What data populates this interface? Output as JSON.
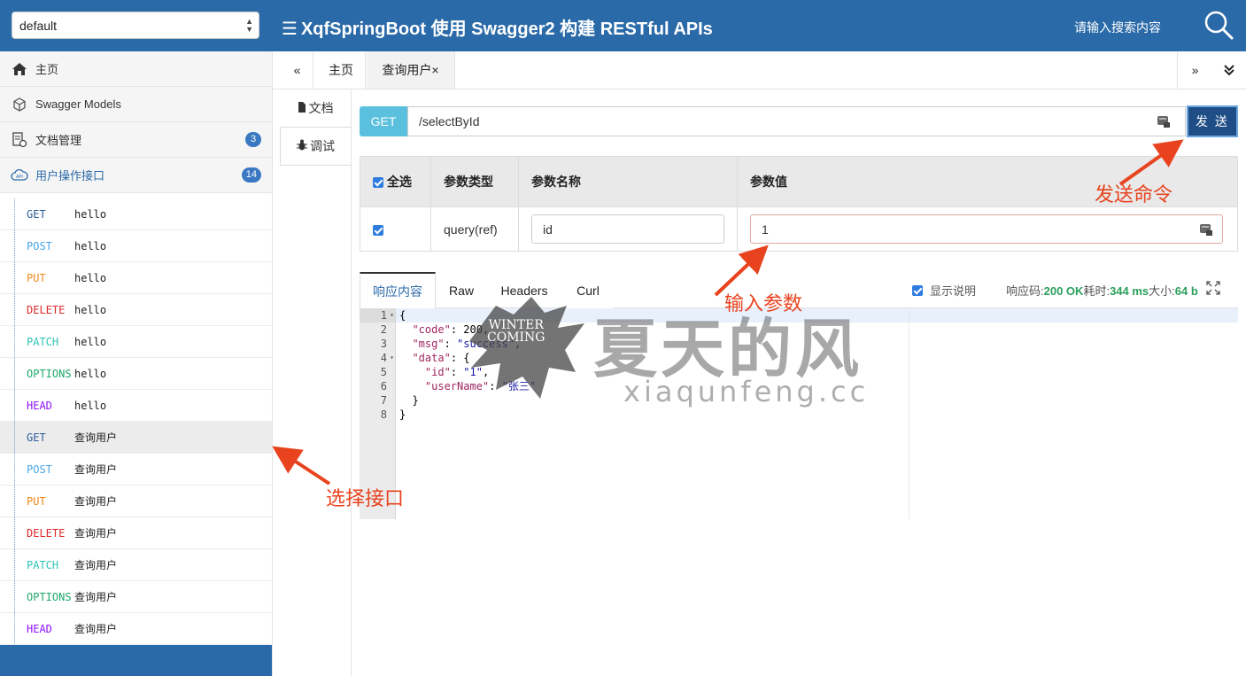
{
  "header": {
    "group_select": "default",
    "title": "XqfSpringBoot 使用 Swagger2 构建 RESTful APIs",
    "search_placeholder": "请输入搜索内容"
  },
  "sidebar": {
    "nav": [
      {
        "label": "主页",
        "icon": "home-icon"
      },
      {
        "label": "Swagger Models",
        "icon": "cube-icon"
      },
      {
        "label": "文档管理",
        "icon": "doc-settings-icon",
        "badge": "3"
      },
      {
        "label": "用户操作接口",
        "icon": "cloud-api-icon",
        "badge": "14"
      }
    ],
    "apis": [
      {
        "method": "GET",
        "name": "hello"
      },
      {
        "method": "POST",
        "name": "hello"
      },
      {
        "method": "PUT",
        "name": "hello"
      },
      {
        "method": "DELETE",
        "name": "hello"
      },
      {
        "method": "PATCH",
        "name": "hello"
      },
      {
        "method": "OPTIONS",
        "name": "hello"
      },
      {
        "method": "HEAD",
        "name": "hello"
      },
      {
        "method": "GET",
        "name": "查询用户",
        "selected": true
      },
      {
        "method": "POST",
        "name": "查询用户"
      },
      {
        "method": "PUT",
        "name": "查询用户"
      },
      {
        "method": "DELETE",
        "name": "查询用户"
      },
      {
        "method": "PATCH",
        "name": "查询用户"
      },
      {
        "method": "OPTIONS",
        "name": "查询用户"
      },
      {
        "method": "HEAD",
        "name": "查询用户"
      }
    ]
  },
  "tabs": {
    "prev": "«",
    "home": "主页",
    "current": "查询用户",
    "close": "×",
    "next": "»"
  },
  "doc_tabs": {
    "doc": "文档",
    "debug": "调试"
  },
  "request": {
    "method": "GET",
    "url": "/selectById",
    "send": "发 送"
  },
  "params": {
    "headers": {
      "select_all": "全选",
      "type": "参数类型",
      "name": "参数名称",
      "value": "参数值"
    },
    "rows": [
      {
        "checked": true,
        "type": "query(ref)",
        "name": "id",
        "value": "1"
      }
    ]
  },
  "response": {
    "tabs": [
      "响应内容",
      "Raw",
      "Headers",
      "Curl"
    ],
    "show_desc": "显示说明",
    "status_label": "响应码:",
    "status_value": "200 OK",
    "time_label": "耗时:",
    "time_value": "344 ms",
    "size_label": "大小:",
    "size_value": "64 b",
    "line_numbers": [
      "1",
      "2",
      "3",
      "4",
      "5",
      "6",
      "7",
      "8"
    ],
    "code": {
      "l1": "{",
      "l2_key": "\"code\"",
      "l2_val": "200",
      "l3_key": "\"msg\"",
      "l3_val": "\"success\"",
      "l4_key": "\"data\"",
      "l4_rest": ": {",
      "l5_key": "\"id\"",
      "l5_val": "\"1\"",
      "l6_key": "\"userName\"",
      "l6_val": "\"张三\"",
      "l7": "  }",
      "l8": "}"
    }
  },
  "watermark": {
    "main": "夏天的风",
    "sub": "xiaqunfeng.cc",
    "badge_line1": "WINTER",
    "badge_line2": "COMING"
  },
  "annotations": {
    "send": "发送命令",
    "input": "输入参数",
    "select": "选择接口"
  },
  "colors": {
    "header": "#2b6aa8",
    "send_button": "#1f4e87",
    "get_tag": "#5bc0de",
    "annotation": "#e8431e",
    "status": "#2ba05a"
  }
}
